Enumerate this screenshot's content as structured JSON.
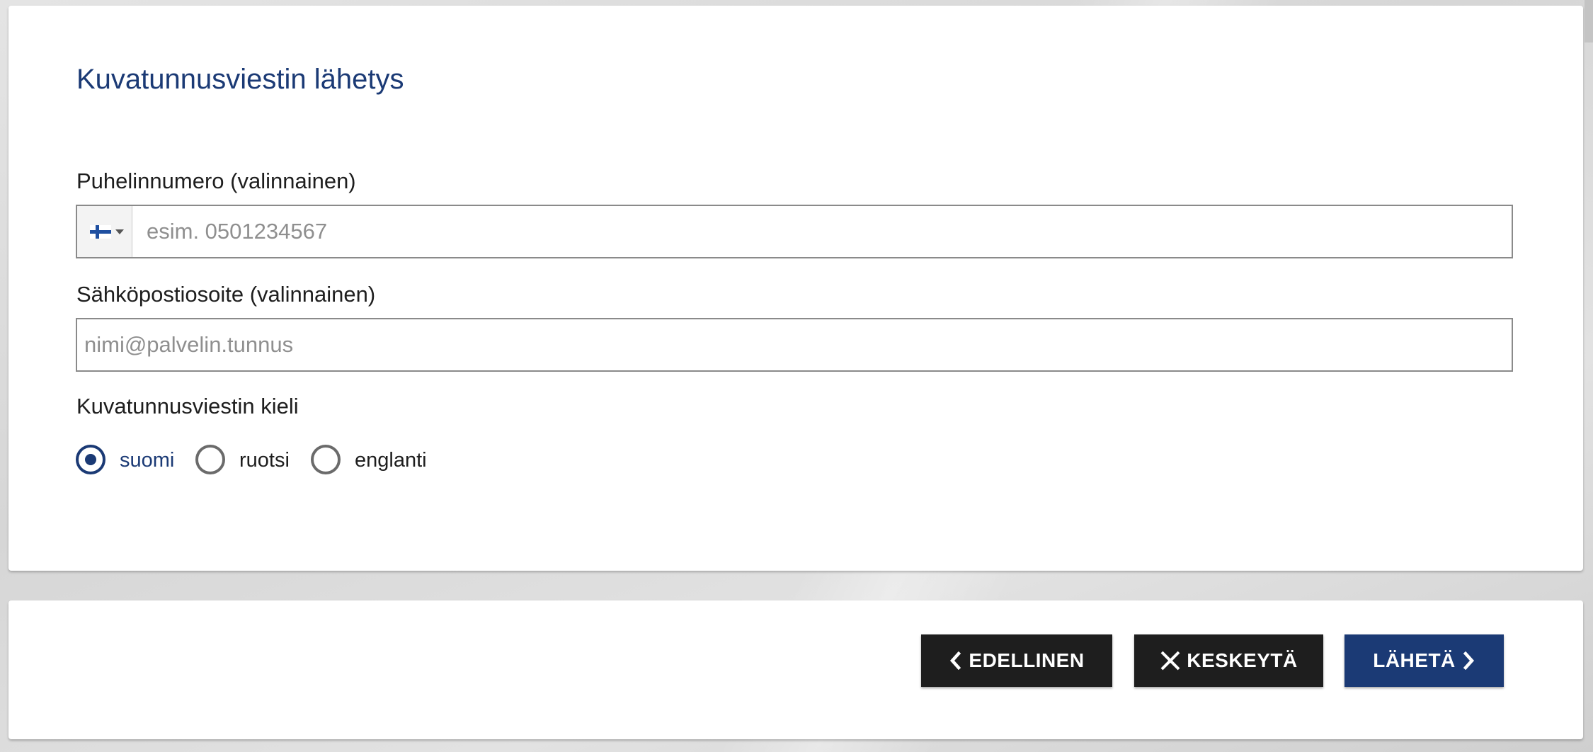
{
  "form": {
    "title": "Kuvatunnusviestin lähetys",
    "phone": {
      "label": "Puhelinnumero (valinnainen)",
      "placeholder": "esim. 0501234567",
      "value": "",
      "country_flag": "finland-flag-icon"
    },
    "email": {
      "label": "Sähköpostiosoite (valinnainen)",
      "placeholder": "nimi@palvelin.tunnus",
      "value": ""
    },
    "language": {
      "label": "Kuvatunnusviestin kieli",
      "selected": "suomi",
      "options": [
        {
          "label": "suomi",
          "checked": true
        },
        {
          "label": "ruotsi",
          "checked": false
        },
        {
          "label": "englanti",
          "checked": false
        }
      ]
    }
  },
  "actions": {
    "previous_label": "EDELLINEN",
    "previous_icon": "chevron-left-icon",
    "cancel_label": "KESKEYTÄ",
    "cancel_icon": "close-icon",
    "send_label": "LÄHETÄ",
    "send_icon": "chevron-right-icon"
  },
  "colors": {
    "primary": "#1b3a75",
    "dark_button": "#1e1e1e",
    "background": "#dcdcdc"
  }
}
